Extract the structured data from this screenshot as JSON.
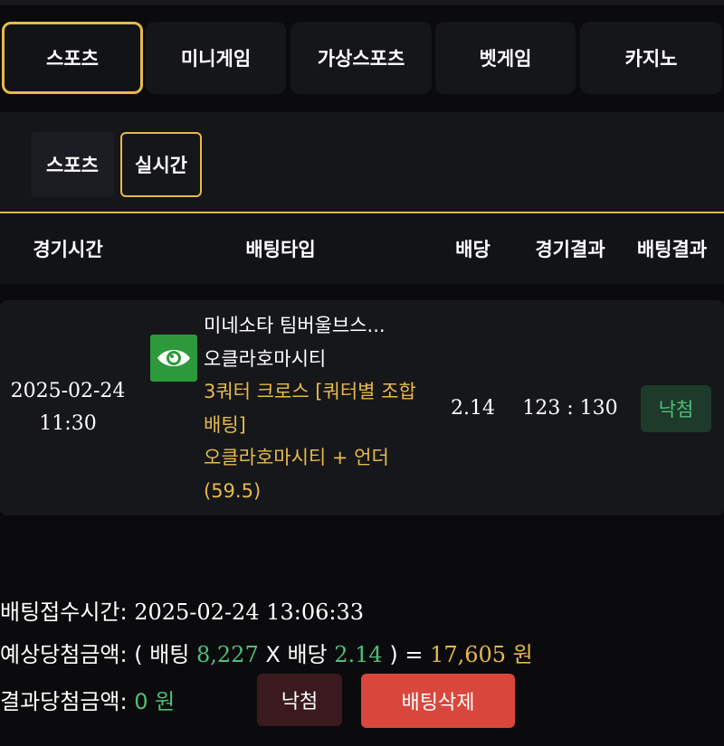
{
  "categories": [
    {
      "label": "스포츠",
      "active": true
    },
    {
      "label": "미니게임",
      "active": false
    },
    {
      "label": "가상스포츠",
      "active": false
    },
    {
      "label": "벳게임",
      "active": false
    },
    {
      "label": "카지노",
      "active": false
    }
  ],
  "subtabs": [
    {
      "label": "스포츠",
      "active": false
    },
    {
      "label": "실시간",
      "active": true
    }
  ],
  "table": {
    "headers": [
      "경기시간",
      "배팅타입",
      "배당",
      "경기결과",
      "배팅결과"
    ],
    "rows": [
      {
        "date": "2025-02-24",
        "time": "11:30",
        "match": "미네소타 팀버울브스...",
        "team": "오클라호마시티",
        "market": "3쿼터 크로스 [쿼터별 조합배팅]",
        "pick": "오클라호마시티 + 언더 (59.5)",
        "odds": "2.14",
        "score": "123 : 130",
        "result": "낙첨"
      }
    ]
  },
  "footer": {
    "receipt_label": "배팅접수시간:",
    "receipt_time": "2025-02-24 13:06:33",
    "expected_label": "예상당첨금액:",
    "open_paren": "( 배팅",
    "bet_amount": "8,227",
    "x_odds": "X 배당",
    "odds": "2.14",
    "equals": ") =",
    "expected_win": "17,605 원",
    "result_label": "결과당첨금액:",
    "result_amount": "0 원",
    "status_button": "낙첨",
    "delete_button": "배팅삭제"
  },
  "colors": {
    "accent": "#e7b94a",
    "green": "#4fbf7b",
    "delete": "#d9473c",
    "view_button": "#2c9a3a"
  },
  "icons": {
    "view": "eye-icon"
  }
}
